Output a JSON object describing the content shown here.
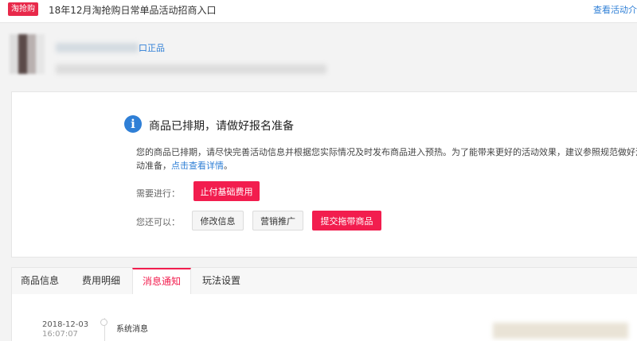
{
  "topbar": {
    "badge": "淘抢购",
    "title": "18年12月淘抢购日常单品活动招商入口",
    "link": "查看活动介"
  },
  "product": {
    "link": "口正品"
  },
  "status": {
    "title": "商品已排期，请做好报名准备",
    "description": "您的商品已排期，请尽快完善活动信息并根据您实际情况及时发布商品进入预热。为了能带来更好的活动效果，建议参照规范做好活动准备，",
    "detail_link": "点击查看详情",
    "period": "。",
    "need_label": "需要进行：",
    "need_button": "止付基础费用",
    "also_label": "您还可以：",
    "modify_button": "修改信息",
    "marketing_button": "营销推广",
    "submit_button": "提交拖带商品"
  },
  "tabs": [
    {
      "label": "商品信息"
    },
    {
      "label": "费用明细"
    },
    {
      "label": "消息通知"
    },
    {
      "label": "玩法设置"
    }
  ],
  "active_tab": "消息通知",
  "messages": [
    {
      "date": "2018-12-03",
      "time": "16:07:07",
      "type": "系统消息"
    }
  ],
  "colors": {
    "accent": "#f21d4e",
    "link": "#2f7fd6",
    "badge": "#e8294a"
  },
  "icons": {
    "info": "info-icon"
  }
}
